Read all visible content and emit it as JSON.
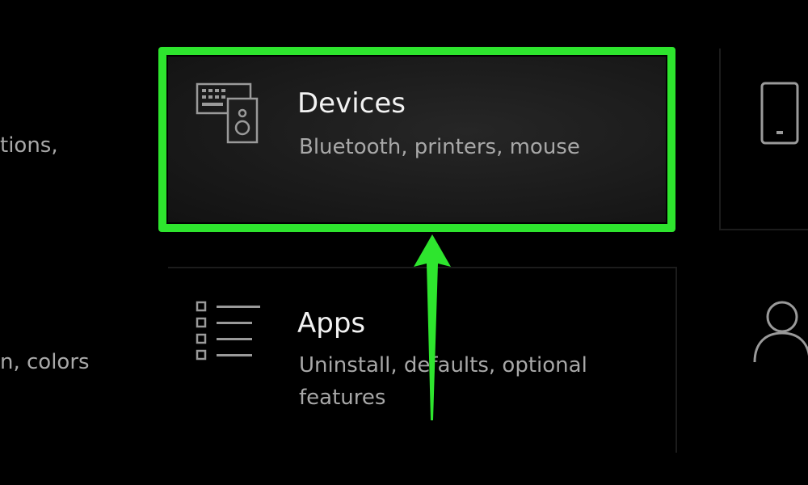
{
  "tiles": {
    "left_partial_top": {
      "text": "tions,"
    },
    "left_partial_bottom": {
      "text": "n, colors"
    },
    "devices": {
      "title": "Devices",
      "description": "Bluetooth, printers, mouse",
      "icon": "keyboard-speaker-icon"
    },
    "apps": {
      "title": "Apps",
      "description": "Uninstall, defaults, optional features",
      "icon": "apps-list-icon"
    },
    "phone": {
      "icon": "phone-icon"
    },
    "accounts": {
      "icon": "person-icon"
    }
  },
  "annotation": {
    "highlight_color": "#2ee52e",
    "arrow_color": "#2ee52e"
  }
}
